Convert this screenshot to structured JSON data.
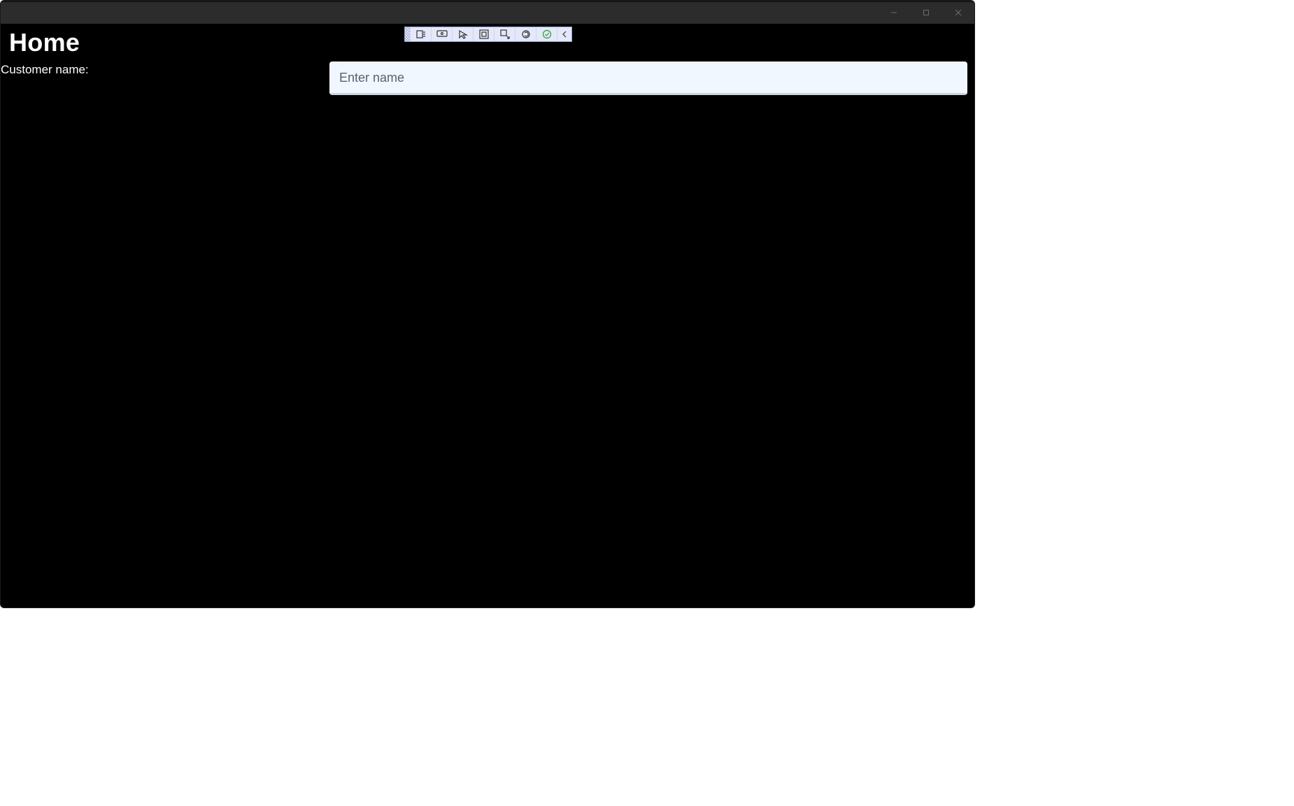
{
  "window": {
    "controls": {
      "minimize": "minimize",
      "maximize": "maximize",
      "close": "close"
    }
  },
  "header": {
    "title": "Home"
  },
  "diag_toolbar": {
    "buttons": [
      "live-visual-tree",
      "live-preview",
      "select-element",
      "display-layout",
      "track-focus",
      "hot-reload",
      "status-ok",
      "collapse"
    ]
  },
  "form": {
    "customer_name": {
      "label": "Customer name:",
      "placeholder": "Enter name",
      "value": ""
    }
  }
}
